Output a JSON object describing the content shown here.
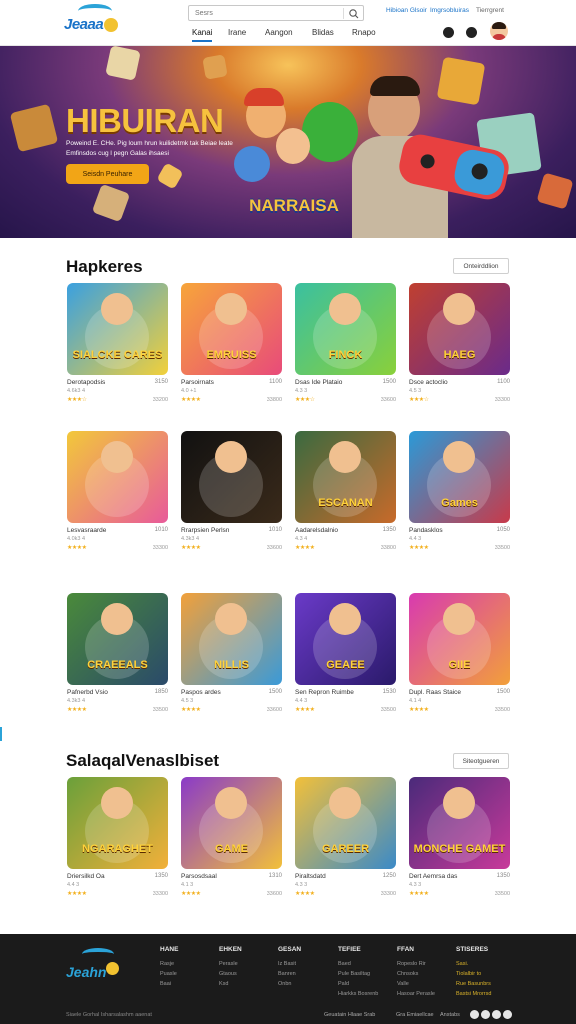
{
  "header": {
    "logo_text": "Jeaaa",
    "search_placeholder": "Sesrs",
    "top_links": [
      "Hibioan Glsoir",
      "Imgrsobluiras",
      "Tierrgrent"
    ],
    "nav": [
      "Kanai",
      "Irane",
      "Aangon",
      "Blidas",
      "Rnapo"
    ],
    "active_nav": 0
  },
  "hero": {
    "title": "HIBUIRAN",
    "subtitle": "Poweind E. CHe. Pig loum hrun kuilidetmk tak Beiae leate Emfinsdos cug l pegn Galas ihsaesi",
    "button": "Seisdn Peuhare",
    "badge": "NARRAISA"
  },
  "section1": {
    "title": "Hapkeres",
    "button": "Onteirddlion",
    "rows": [
      [
        {
          "title": "Derotapodsis",
          "count": "3150",
          "sub": "4.6k3 4",
          "stars": "★★★☆",
          "price": "33200",
          "art": "SIALCKE CARES",
          "bg1": "#3aa0e0",
          "bg2": "#f2d03a"
        },
        {
          "title": "Parsoirnats",
          "count": "1100",
          "sub": "4.0 +1",
          "stars": "★★★★",
          "price": "33800",
          "art": "EMRUISS",
          "bg1": "#f7a53a",
          "bg2": "#e84b7a"
        },
        {
          "title": "Dsas Ide Plataio",
          "count": "1500",
          "sub": "4.3 3",
          "stars": "★★★☆",
          "price": "33600",
          "art": "FINCK",
          "bg1": "#3ac0a0",
          "bg2": "#8ad03a"
        },
        {
          "title": "Dsce actoclio",
          "count": "1100",
          "sub": "4.5 3",
          "stars": "★★★☆",
          "price": "33300",
          "art": "HAEG",
          "bg1": "#c04030",
          "bg2": "#6a2a8a"
        }
      ],
      [
        {
          "title": "Lesvasraarde",
          "count": "1010",
          "sub": "4.0k3 4",
          "stars": "★★★★",
          "price": "33300",
          "art": "",
          "bg1": "#f2c83a",
          "bg2": "#e85a9a"
        },
        {
          "title": "Rrarpsien Perlsn",
          "count": "1010",
          "sub": "4.3k3 4",
          "stars": "★★★★",
          "price": "33600",
          "art": "",
          "bg1": "#111111",
          "bg2": "#3a2a1a"
        },
        {
          "title": "Aadarelsdalnio",
          "count": "1350",
          "sub": "4.3 4",
          "stars": "★★★★",
          "price": "33800",
          "art": "ESCANAN",
          "bg1": "#3a6a40",
          "bg2": "#c86a2a"
        },
        {
          "title": "Pandasklos",
          "count": "1050",
          "sub": "4.4 3",
          "stars": "★★★★",
          "price": "33500",
          "art": "Games",
          "bg1": "#2a9ad8",
          "bg2": "#c83a4a"
        }
      ],
      [
        {
          "title": "Pafnerbd Vsio",
          "count": "1850",
          "sub": "4.3k3 4",
          "stars": "★★★★",
          "price": "33500",
          "art": "CRAEEALS",
          "bg1": "#4a8a3a",
          "bg2": "#2a4a6a"
        },
        {
          "title": "Paspos ardes",
          "count": "1500",
          "sub": "4.5 3",
          "stars": "★★★★",
          "price": "33600",
          "art": "NILLIS",
          "bg1": "#f2a03a",
          "bg2": "#3a9ad8"
        },
        {
          "title": "Sen Repron Ruimbe",
          "count": "1530",
          "sub": "4.4 3",
          "stars": "★★★★",
          "price": "33500",
          "art": "GEAEE",
          "bg1": "#6a3ac8",
          "bg2": "#2a1a6a"
        },
        {
          "title": "Dupl. Raas Staice",
          "count": "1500",
          "sub": "4.1 4",
          "stars": "★★★★",
          "price": "33500",
          "art": "GIIE",
          "bg1": "#d83ab0",
          "bg2": "#f2a03a"
        }
      ]
    ]
  },
  "section2": {
    "title": "SalaqalVenaslbiset",
    "button": "Siteotgueren",
    "cards": [
      {
        "title": "Driersilkd Oa",
        "count": "1350",
        "sub": "4.4 3",
        "stars": "★★★★",
        "price": "33300",
        "art": "NGARAGHET",
        "bg1": "#6aa03a",
        "bg2": "#f2b03a"
      },
      {
        "title": "Parsosdsaal",
        "count": "1310",
        "sub": "4.1 3",
        "stars": "★★★★",
        "price": "33600",
        "art": "GAME",
        "bg1": "#8a3ac8",
        "bg2": "#f2c03a"
      },
      {
        "title": "Piraltsdatd",
        "count": "1250",
        "sub": "4.3 3",
        "stars": "★★★★",
        "price": "33300",
        "art": "GAREER",
        "bg1": "#f2c03a",
        "bg2": "#3a8ac8"
      },
      {
        "title": "Dert Aemrsa das",
        "count": "1350",
        "sub": "4.3 3",
        "stars": "★★★★",
        "price": "33500",
        "art": "MONCHE GAMET",
        "bg1": "#4a2a7a",
        "bg2": "#c83a9a"
      }
    ]
  },
  "footer": {
    "logo_text": "Jeahn",
    "columns": [
      {
        "heading": "HANE",
        "items": [
          "Rasje",
          "Puasle",
          "Baai"
        ]
      },
      {
        "heading": "EHKEN",
        "items": [
          "Perasle",
          "Gtaous",
          "Ksd"
        ]
      },
      {
        "heading": "GESAN",
        "items": [
          "Iz Basit",
          "Banren",
          "Onbn"
        ]
      },
      {
        "heading": "TEFIEE",
        "items": [
          "Baed",
          "Pule Basiltag",
          "Pald",
          "Hiarkks Bosrenb"
        ]
      },
      {
        "heading": "FFAN",
        "items": [
          "Ropeslo Rir",
          "Chnsoks",
          "Valle",
          "Hasoar Perasle"
        ]
      },
      {
        "heading": "STISERES",
        "items": [
          "Sasi.",
          "Tiolalbir to",
          "Rue Basunbrs",
          "Bastsi Mrorrsd"
        ]
      }
    ],
    "copyright": "Siaele Gorhal Isharsalashm aaenat",
    "bottom_links": [
      "Geuatain Hlaae Srab",
      "Gra Emiaellcae",
      "Anstabs"
    ]
  },
  "colors": {
    "accent": "#1a73c8",
    "hero_title": "#f6c23e",
    "hero_button": "#f2a516",
    "stars": "#f2b01e",
    "footer_bg": "#1b1b1b"
  }
}
